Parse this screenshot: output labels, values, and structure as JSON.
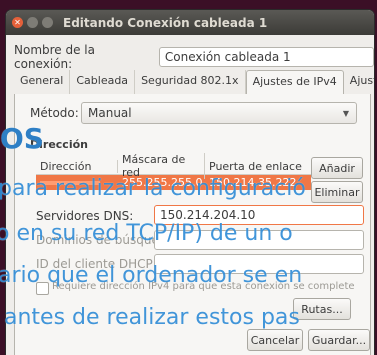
{
  "window": {
    "title": "Editando Conexión cableada 1"
  },
  "connection_name": {
    "label": "Nombre de la conexión:",
    "value": "Conexión cableada 1"
  },
  "tabs": [
    {
      "label": "General"
    },
    {
      "label": "Cableada"
    },
    {
      "label": "Seguridad 802.1x"
    },
    {
      "label": "Ajustes de IPv4"
    },
    {
      "label": "Ajustes de IPv6"
    }
  ],
  "method": {
    "label": "Método:",
    "value": "Manual"
  },
  "addresses": {
    "section_label": "Dirección",
    "columns": [
      "Dirección",
      "Máscara de red",
      "Puerta de enlace"
    ],
    "rows": [
      {
        "address": "",
        "netmask": "255.255.255.0",
        "gateway": "150.214.35.222"
      }
    ],
    "add_label": "Añadir",
    "delete_label": "Eliminar"
  },
  "dns": {
    "label": "Servidores DNS:",
    "value": "150.214.204.10"
  },
  "search_domains": {
    "label": "Dominios de búsqueda:"
  },
  "dhcp_client": {
    "label": "ID del cliente DHCP:"
  },
  "require_ipv4": {
    "label": "Requiere dirección IPv4 para que esta conexión se complete"
  },
  "routes_label": "Rutas...",
  "cancel_label": "Cancelar",
  "save_label": "Guardar...",
  "overlay_text": {
    "line0": "OS",
    "line1": "para realizar la configuració",
    "line2": "o en su red TCP/IP) de un o",
    "line3": "ario que el ordenador se en",
    "line4": "antes de realizar estos pas"
  }
}
